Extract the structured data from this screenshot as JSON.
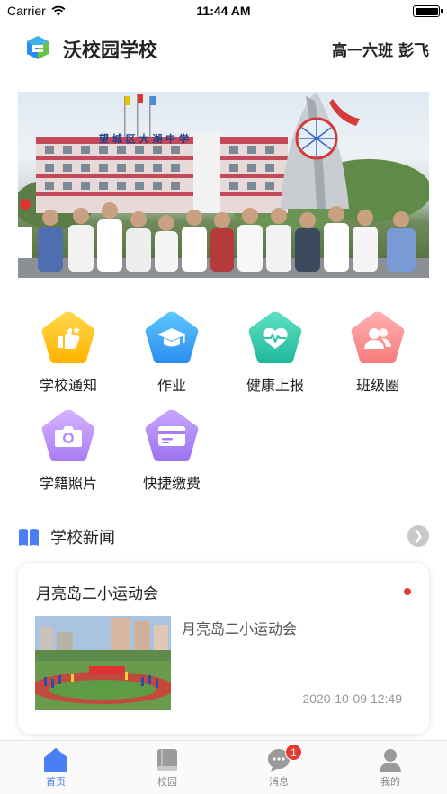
{
  "status_bar": {
    "carrier": "Carrier",
    "time": "11:44 AM"
  },
  "header": {
    "app_title": "沃校园学校",
    "class_info": "高一六班 彭飞",
    "logo_icon": "cube-logo-icon"
  },
  "banner": {
    "image": "school-group-photo",
    "sign_text": "望 城 区 大 湖 中 学"
  },
  "features": [
    {
      "label": "学校通知",
      "icon": "thumbs-up-icon",
      "color_top": "#ffd84d",
      "color_bottom": "#ffb400"
    },
    {
      "label": "作业",
      "icon": "graduation-cap-icon",
      "color_top": "#5ec8ff",
      "color_bottom": "#2a8cf0"
    },
    {
      "label": "健康上报",
      "icon": "heart-pulse-icon",
      "color_top": "#5fe0c2",
      "color_bottom": "#1fb89a"
    },
    {
      "label": "班级圈",
      "icon": "people-icon",
      "color_top": "#ffb0b0",
      "color_bottom": "#f77c7c"
    },
    {
      "label": "学籍照片",
      "icon": "camera-icon",
      "color_top": "#d6b4ff",
      "color_bottom": "#a97cf2"
    },
    {
      "label": "快捷缴费",
      "icon": "card-icon",
      "color_top": "#c7a6ff",
      "color_bottom": "#9b73f0"
    }
  ],
  "news": {
    "section_title": "学校新闻",
    "more_icon": "chevron-right-icon",
    "items": [
      {
        "title": "月亮岛二小运动会",
        "summary": "月亮岛二小运动会",
        "date": "2020-10-09 12:49",
        "unread": true
      }
    ]
  },
  "tab_bar": {
    "tabs": [
      {
        "label": "首页",
        "icon": "home-icon",
        "active": true
      },
      {
        "label": "校园",
        "icon": "book-icon",
        "active": false
      },
      {
        "label": "消息",
        "icon": "chat-bubble-icon",
        "active": false,
        "badge": "1"
      },
      {
        "label": "我的",
        "icon": "person-icon",
        "active": false
      }
    ]
  },
  "colors": {
    "accent": "#4a7ef5",
    "badge": "#e53935"
  }
}
